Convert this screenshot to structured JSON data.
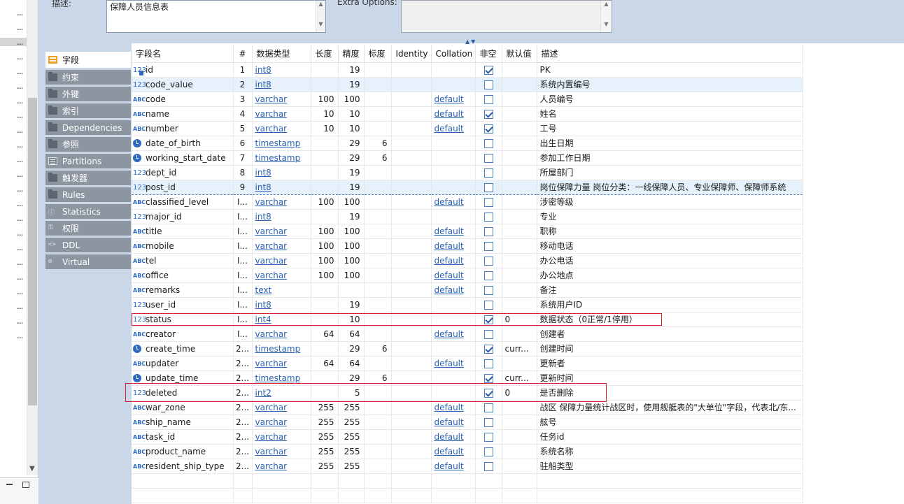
{
  "top": {
    "desc_label": "描述:",
    "desc_value": "保障人员信息表",
    "extra_label": "Extra Options:"
  },
  "tabs": [
    {
      "label": "字段",
      "icon": "fields-icon",
      "active": true
    },
    {
      "label": "约束",
      "icon": "folder-icon"
    },
    {
      "label": "外键",
      "icon": "folder-icon"
    },
    {
      "label": "索引",
      "icon": "folder-icon"
    },
    {
      "label": "Dependencies",
      "icon": "folder-icon"
    },
    {
      "label": "参照",
      "icon": "folder-icon"
    },
    {
      "label": "Partitions",
      "icon": "list-icon"
    },
    {
      "label": "触发器",
      "icon": "folder-icon"
    },
    {
      "label": "Rules",
      "icon": "folder-icon"
    },
    {
      "label": "Statistics",
      "icon": "info-icon"
    },
    {
      "label": "权限",
      "icon": "key-icon"
    },
    {
      "label": "DDL",
      "icon": "code-icon"
    },
    {
      "label": "Virtual",
      "icon": "virtual-icon"
    }
  ],
  "columns": [
    "字段名",
    "#",
    "数据类型",
    "长度",
    "精度",
    "标度",
    "Identity",
    "Collation",
    "非空",
    "默认值",
    "描述"
  ],
  "rows": [
    {
      "icon": "key",
      "name": "id",
      "ord": "1",
      "type": "int8",
      "len": "",
      "prec": "19",
      "scale": "",
      "coll": "",
      "notnull": true,
      "def": "",
      "desc": "PK"
    },
    {
      "icon": "num",
      "name": "code_value",
      "ord": "2",
      "type": "int8",
      "len": "",
      "prec": "19",
      "scale": "",
      "coll": "",
      "notnull": false,
      "def": "",
      "desc": "系统内置编号"
    },
    {
      "icon": "abc",
      "name": "code",
      "ord": "3",
      "type": "varchar",
      "len": "100",
      "prec": "100",
      "scale": "",
      "coll": "default",
      "notnull": false,
      "def": "",
      "desc": "人员编号"
    },
    {
      "icon": "abc",
      "name": "name",
      "ord": "4",
      "type": "varchar",
      "len": "10",
      "prec": "10",
      "scale": "",
      "coll": "default",
      "notnull": true,
      "def": "",
      "desc": "姓名"
    },
    {
      "icon": "abc",
      "name": "number",
      "ord": "5",
      "type": "varchar",
      "len": "10",
      "prec": "10",
      "scale": "",
      "coll": "default",
      "notnull": true,
      "def": "",
      "desc": "工号"
    },
    {
      "icon": "clock",
      "name": "date_of_birth",
      "ord": "6",
      "type": "timestamp",
      "len": "",
      "prec": "29",
      "scale": "6",
      "coll": "",
      "notnull": false,
      "def": "",
      "desc": "出生日期"
    },
    {
      "icon": "clock",
      "name": "working_start_date",
      "ord": "7",
      "type": "timestamp",
      "len": "",
      "prec": "29",
      "scale": "6",
      "coll": "",
      "notnull": false,
      "def": "",
      "desc": "参加工作日期"
    },
    {
      "icon": "num",
      "name": "dept_id",
      "ord": "8",
      "type": "int8",
      "len": "",
      "prec": "19",
      "scale": "",
      "coll": "",
      "notnull": false,
      "def": "",
      "desc": "所屋部门"
    },
    {
      "icon": "num",
      "name": "post_id",
      "ord": "9",
      "type": "int8",
      "len": "",
      "prec": "19",
      "scale": "",
      "coll": "",
      "notnull": false,
      "def": "",
      "desc": "岗位保障力量 岗位分类：一线保障人员、专业保障师、保障师系统"
    },
    {
      "icon": "abc",
      "name": "classified_level",
      "ord": "I...",
      "type": "varchar",
      "len": "100",
      "prec": "100",
      "scale": "",
      "coll": "default",
      "notnull": false,
      "def": "",
      "desc": "涉密等级"
    },
    {
      "icon": "num",
      "name": "major_id",
      "ord": "I...",
      "type": "int8",
      "len": "",
      "prec": "19",
      "scale": "",
      "coll": "",
      "notnull": false,
      "def": "",
      "desc": "专业"
    },
    {
      "icon": "abc",
      "name": "title",
      "ord": "I...",
      "type": "varchar",
      "len": "100",
      "prec": "100",
      "scale": "",
      "coll": "default",
      "notnull": false,
      "def": "",
      "desc": "职称"
    },
    {
      "icon": "abc",
      "name": "mobile",
      "ord": "I...",
      "type": "varchar",
      "len": "100",
      "prec": "100",
      "scale": "",
      "coll": "default",
      "notnull": false,
      "def": "",
      "desc": "移动电话"
    },
    {
      "icon": "abc",
      "name": "tel",
      "ord": "I...",
      "type": "varchar",
      "len": "100",
      "prec": "100",
      "scale": "",
      "coll": "default",
      "notnull": false,
      "def": "",
      "desc": "办公电话"
    },
    {
      "icon": "abc",
      "name": "office",
      "ord": "I...",
      "type": "varchar",
      "len": "100",
      "prec": "100",
      "scale": "",
      "coll": "default",
      "notnull": false,
      "def": "",
      "desc": "办公地点"
    },
    {
      "icon": "abc",
      "name": "remarks",
      "ord": "I...",
      "type": "text",
      "len": "",
      "prec": "",
      "scale": "",
      "coll": "default",
      "notnull": false,
      "def": "",
      "desc": "备注"
    },
    {
      "icon": "num",
      "name": "user_id",
      "ord": "I...",
      "type": "int8",
      "len": "",
      "prec": "19",
      "scale": "",
      "coll": "",
      "notnull": false,
      "def": "",
      "desc": "系统用户ID"
    },
    {
      "icon": "num",
      "name": "status",
      "ord": "I...",
      "type": "int4",
      "len": "",
      "prec": "10",
      "scale": "",
      "coll": "",
      "notnull": true,
      "def": "0",
      "desc": "数据状态（0正常/1停用）"
    },
    {
      "icon": "abc",
      "name": "creator",
      "ord": "I...",
      "type": "varchar",
      "len": "64",
      "prec": "64",
      "scale": "",
      "coll": "default",
      "notnull": false,
      "def": "",
      "desc": "创建者"
    },
    {
      "icon": "clock",
      "name": "create_time",
      "ord": "2...",
      "type": "timestamp",
      "len": "",
      "prec": "29",
      "scale": "6",
      "coll": "",
      "notnull": true,
      "def": "curr...",
      "desc": "创建时间"
    },
    {
      "icon": "abc",
      "name": "updater",
      "ord": "2...",
      "type": "varchar",
      "len": "64",
      "prec": "64",
      "scale": "",
      "coll": "default",
      "notnull": false,
      "def": "",
      "desc": "更新者"
    },
    {
      "icon": "clock",
      "name": "update_time",
      "ord": "2...",
      "type": "timestamp",
      "len": "",
      "prec": "29",
      "scale": "6",
      "coll": "",
      "notnull": true,
      "def": "curr...",
      "desc": "更新时间"
    },
    {
      "icon": "num",
      "name": "deleted",
      "ord": "2...",
      "type": "int2",
      "len": "",
      "prec": "5",
      "scale": "",
      "coll": "",
      "notnull": true,
      "def": "0",
      "desc": "是否删除"
    },
    {
      "icon": "abc",
      "name": "war_zone",
      "ord": "2...",
      "type": "varchar",
      "len": "255",
      "prec": "255",
      "scale": "",
      "coll": "default",
      "notnull": false,
      "def": "",
      "desc": "战区 保障力量统计战区时，使用舰艇表的\"大单位\"字段，代表北/东..."
    },
    {
      "icon": "abc",
      "name": "ship_name",
      "ord": "2...",
      "type": "varchar",
      "len": "255",
      "prec": "255",
      "scale": "",
      "coll": "default",
      "notnull": false,
      "def": "",
      "desc": "舷号"
    },
    {
      "icon": "abc",
      "name": "task_id",
      "ord": "2...",
      "type": "varchar",
      "len": "255",
      "prec": "255",
      "scale": "",
      "coll": "default",
      "notnull": false,
      "def": "",
      "desc": "任务id"
    },
    {
      "icon": "abc",
      "name": "product_name",
      "ord": "2...",
      "type": "varchar",
      "len": "255",
      "prec": "255",
      "scale": "",
      "coll": "default",
      "notnull": false,
      "def": "",
      "desc": "系统名称"
    },
    {
      "icon": "abc",
      "name": "resident_ship_type",
      "ord": "2...",
      "type": "varchar",
      "len": "255",
      "prec": "255",
      "scale": "",
      "coll": "default",
      "notnull": false,
      "def": "",
      "desc": "驻船类型"
    }
  ],
  "left_rows": [
    "...",
    "...",
    "...",
    "...",
    "...",
    "...",
    "...",
    "...",
    "...",
    "...",
    "...",
    "...",
    "...",
    "...",
    "...",
    "...",
    "...",
    "...",
    "...",
    "...",
    "...",
    "...",
    "..."
  ],
  "colors": {
    "accent": "#2a62b5",
    "panel": "#c9d7e9",
    "highlight_box": "#d9242e",
    "tab_inactive": "#8c95a0"
  }
}
